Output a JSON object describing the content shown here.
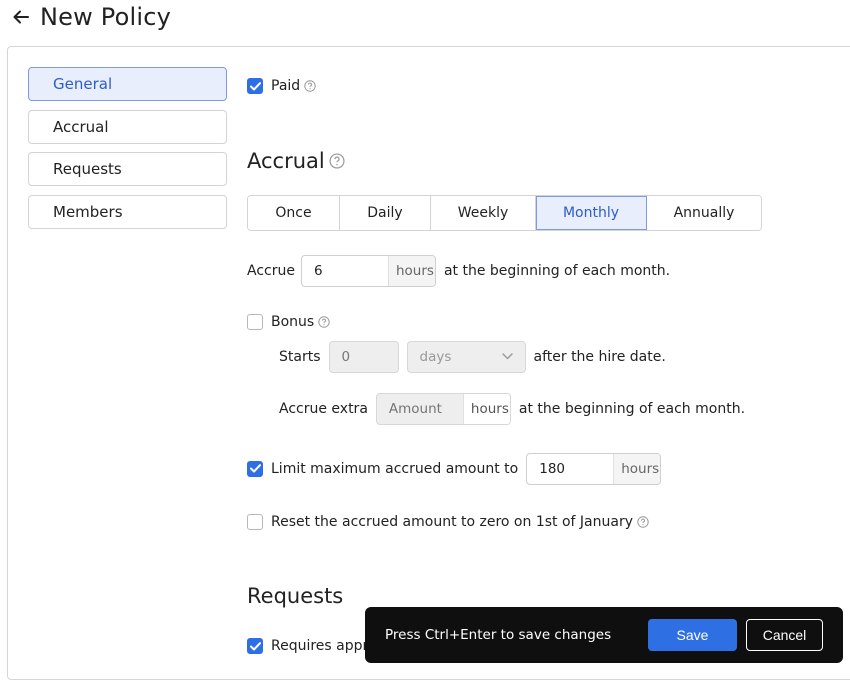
{
  "header": {
    "title": "New Policy"
  },
  "nav": {
    "items": [
      {
        "label": "General",
        "active": true
      },
      {
        "label": "Accrual",
        "active": false
      },
      {
        "label": "Requests",
        "active": false
      },
      {
        "label": "Members",
        "active": false
      }
    ]
  },
  "general": {
    "paid_label": "Paid",
    "paid_checked": true
  },
  "accrual": {
    "title": "Accrual",
    "frequency_options": [
      "Once",
      "Daily",
      "Weekly",
      "Monthly",
      "Annually"
    ],
    "frequency_selected": "Monthly",
    "accrue_label": "Accrue",
    "accrue_value": "6",
    "accrue_unit": "hours",
    "accrue_suffix": "at the beginning of each month.",
    "bonus": {
      "label": "Bonus",
      "checked": false,
      "starts_label": "Starts",
      "starts_placeholder": "0",
      "starts_unit_select": "days",
      "starts_suffix": "after the hire date.",
      "extra_label": "Accrue extra",
      "extra_placeholder": "Amount",
      "extra_unit": "hours",
      "extra_suffix": "at the beginning of each month."
    },
    "limit": {
      "label": "Limit maximum accrued amount to",
      "checked": true,
      "value": "180",
      "unit": "hours"
    },
    "reset": {
      "label": "Reset the accrued amount to zero on 1st of January",
      "checked": false
    }
  },
  "requests": {
    "title": "Requests",
    "requires_approval_label": "Requires approval",
    "requires_approval_checked": true
  },
  "toast": {
    "message": "Press Ctrl+Enter to save changes",
    "save_label": "Save",
    "cancel_label": "Cancel"
  },
  "colors": {
    "accent": "#2f6fe4",
    "active_bg": "#e8eefb",
    "active_text": "#2e5cc9",
    "toast_bg": "#0f0f0f"
  },
  "icons": {
    "back": "arrow-left-icon",
    "help": "question-circle-icon",
    "check": "checkmark-icon",
    "chevron": "chevron-down-icon"
  }
}
